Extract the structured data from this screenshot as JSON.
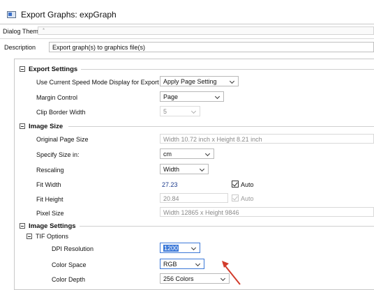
{
  "window": {
    "title": "Export Graphs: expGraph"
  },
  "top": {
    "dialog_theme_label": "Dialog Theme",
    "dialog_theme_value": "*",
    "description_label": "Description",
    "description_value": "Export graph(s) to graphics file(s)"
  },
  "export_settings": {
    "header": "Export Settings",
    "rows": [
      {
        "label": "Use Current Speed Mode Display for Export",
        "value": "Apply Page Setting"
      },
      {
        "label": "Margin Control",
        "value": "Page"
      },
      {
        "label": "Clip Border Width",
        "value": "5"
      }
    ]
  },
  "image_size": {
    "header": "Image Size",
    "original_page_size_label": "Original Page Size",
    "original_page_size_value": "Width 10.72 inch x Height 8.21 inch",
    "specify_size_label": "Specify Size in:",
    "specify_size_value": "cm",
    "rescaling_label": "Rescaling",
    "rescaling_value": "Width",
    "fit_width_label": "Fit Width",
    "fit_width_value": "27.23",
    "fit_width_auto": "Auto",
    "fit_height_label": "Fit Height",
    "fit_height_value": "20.84",
    "fit_height_auto": "Auto",
    "pixel_size_label": "Pixel Size",
    "pixel_size_value": "Width 12865 x Height 9846"
  },
  "image_settings": {
    "header": "Image Settings",
    "tif_header": "TIF Options",
    "dpi_label": "DPI Resolution",
    "dpi_value": "1200",
    "color_space_label": "Color Space",
    "color_space_value": "RGB",
    "color_depth_label": "Color Depth",
    "color_depth_value": "256 Colors"
  },
  "colors": {
    "accent": "#3b78d8",
    "value_blue": "#1b3a8c",
    "annotation_arrow": "#d23c2c"
  }
}
